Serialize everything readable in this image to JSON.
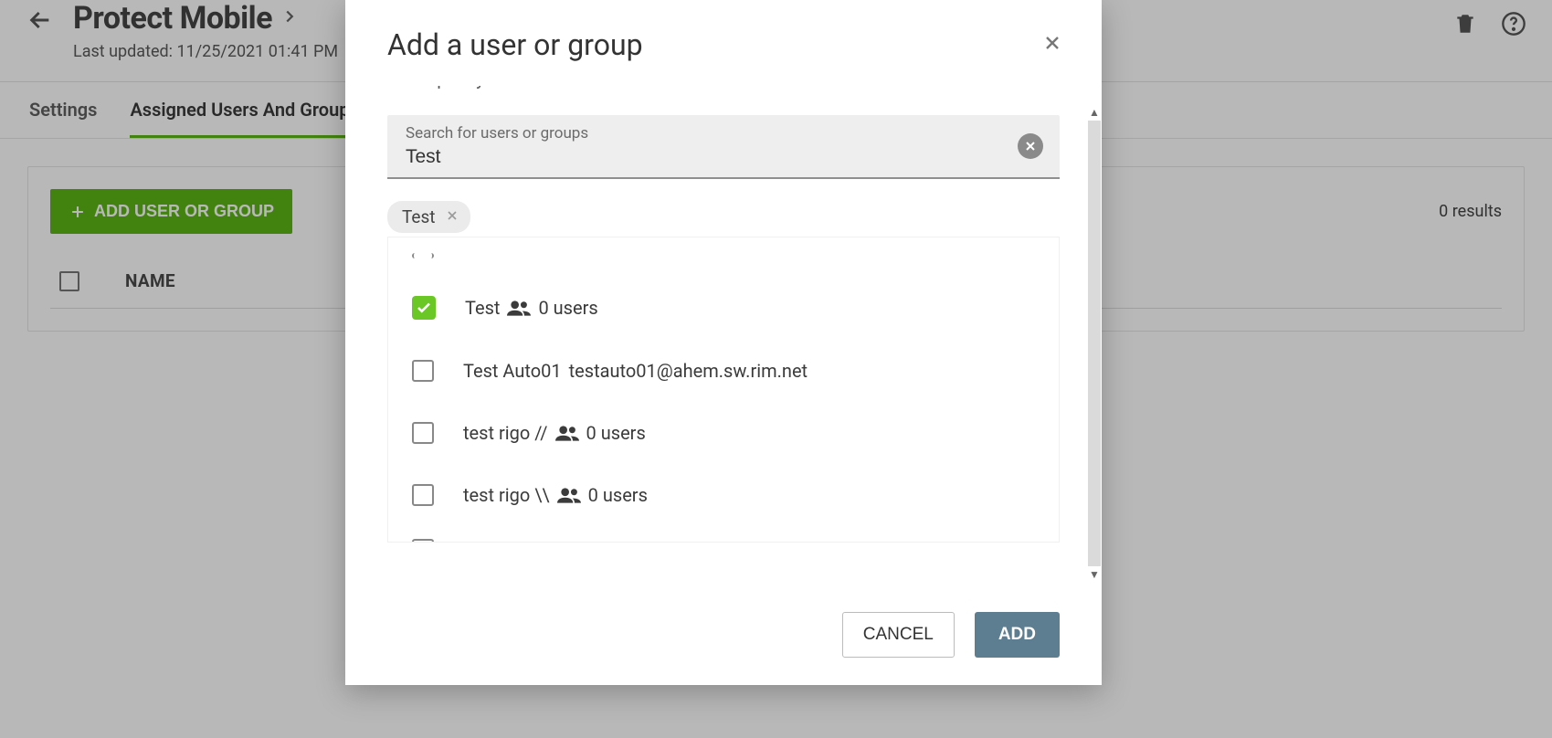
{
  "header": {
    "title": "Protect Mobile",
    "subtitle": "Last updated: 11/25/2021 01:41 PM"
  },
  "tabs": {
    "settings": "Settings",
    "assigned": "Assigned Users And Groups"
  },
  "panel": {
    "add_button": "ADD USER OR GROUP",
    "results_text": "0 results",
    "name_header": "NAME"
  },
  "modal": {
    "title": "Add a user or group",
    "hint_fragment": "same policy.",
    "search_label": "Search for users or groups",
    "search_value": "Test",
    "chip": "Test",
    "results": [
      {
        "checked": true,
        "label": "Test",
        "is_group": true,
        "extra": "0 users",
        "email": ""
      },
      {
        "checked": false,
        "label": "Test Auto01",
        "is_group": false,
        "extra": "",
        "email": "testauto01@ahem.sw.rim.net"
      },
      {
        "checked": false,
        "label": "test rigo //",
        "is_group": true,
        "extra": "0 users",
        "email": ""
      },
      {
        "checked": false,
        "label": "test rigo \\\\",
        "is_group": true,
        "extra": "0 users",
        "email": ""
      }
    ],
    "cancel": "CANCEL",
    "add": "ADD"
  }
}
